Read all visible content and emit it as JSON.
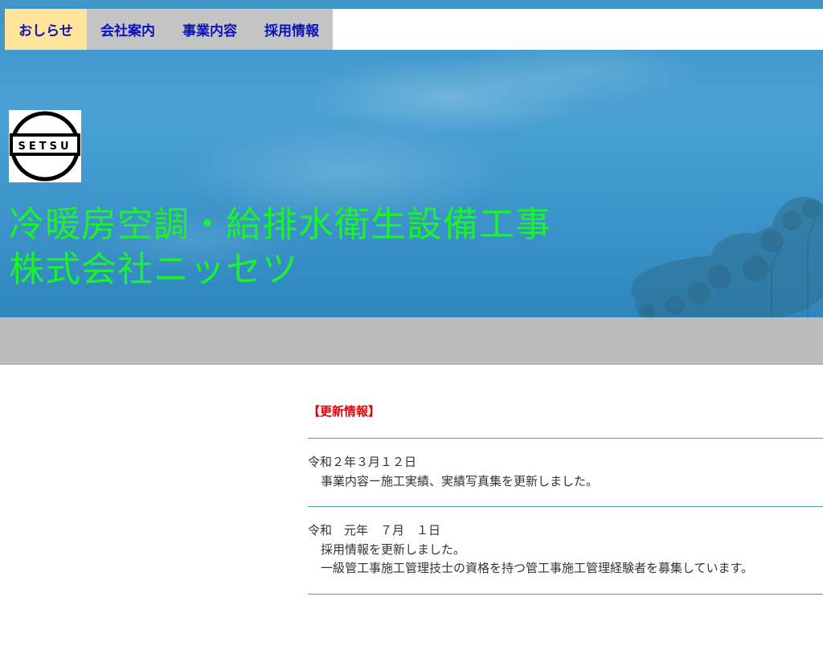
{
  "nav": {
    "items": [
      {
        "label": "おしらせ"
      },
      {
        "label": "会社案内"
      },
      {
        "label": "事業内容"
      },
      {
        "label": "採用情報"
      }
    ]
  },
  "banner": {
    "logo_text": "SETSU",
    "title_line1": "冷暖房空調・給排水衛生設備工事",
    "title_line2": "株式会社ニッセツ"
  },
  "news": {
    "heading": "【更新情報】",
    "entries": [
      {
        "date": "令和２年３月１２日",
        "lines": [
          "事業内容ー施工実績、実績写真集を更新しました。"
        ]
      },
      {
        "date": "令和　元年　７月　１日",
        "lines": [
          "採用情報を更新しました。",
          "一級管工事施工管理技士の資格を持つ管工事施工管理経験者を募集しています。"
        ]
      }
    ]
  },
  "colors": {
    "nav_active_bg": "#ffe49a",
    "nav_bg": "#c4c4c4",
    "nav_text": "#0b13b8",
    "title_text": "#1cf22c",
    "heading_text": "#e8000b",
    "divider": "#4a9ab0",
    "gray_band": "#bcbcbc"
  }
}
